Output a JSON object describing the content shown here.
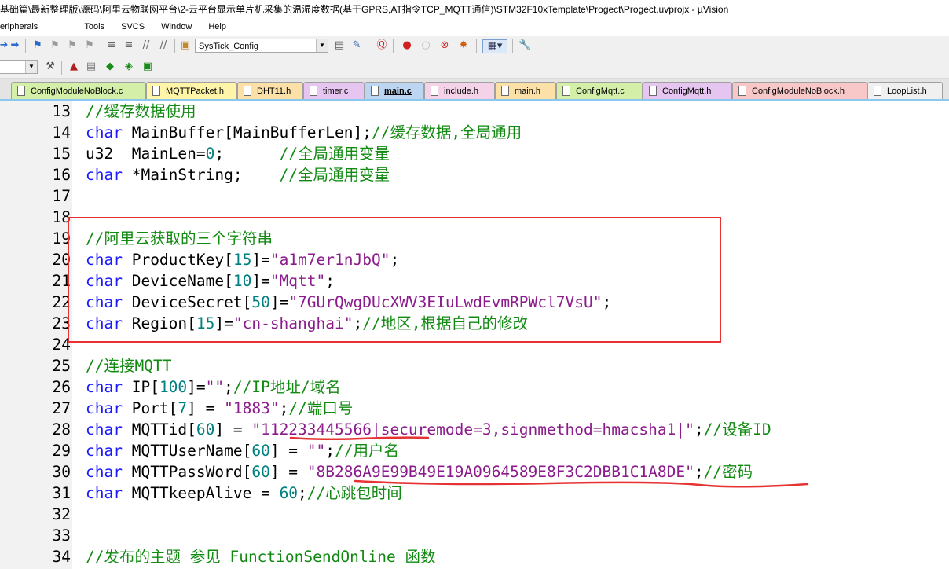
{
  "window": {
    "title": "基础篇\\最新整理版\\源码\\阿里云物联网平台\\2-云平台显示单片机采集的温湿度数据(基于GPRS,AT指令TCP_MQTT通信)\\STM32F10xTemplate\\Progect\\Progect.uvprojx - µVision"
  },
  "menu": [
    "eripherals",
    "Tools",
    "SVCS",
    "Window",
    "Help"
  ],
  "toolbar": {
    "target_combo": "SysTick_Config"
  },
  "tabs": [
    {
      "label": "ConfigModuleNoBlock.c",
      "color": "#d4f0a8"
    },
    {
      "label": "MQTTPacket.h",
      "color": "#fff5a8"
    },
    {
      "label": "DHT11.h",
      "color": "#fbe0a8"
    },
    {
      "label": "timer.c",
      "color": "#e6c6f0"
    },
    {
      "label": "main.c",
      "color": "#bcd6f2"
    },
    {
      "label": "include.h",
      "color": "#f4d2e8"
    },
    {
      "label": "main.h",
      "color": "#fbe0a8"
    },
    {
      "label": "ConfigMqtt.c",
      "color": "#d4f0a8"
    },
    {
      "label": "ConfigMqtt.h",
      "color": "#e6c6f0"
    },
    {
      "label": "ConfigModuleNoBlock.h",
      "color": "#f8c8c8"
    },
    {
      "label": "LoopList.h",
      "color": "#f0f0f0"
    }
  ],
  "code": [
    {
      "n": "13",
      "t": [
        [
          "cm",
          "//缓存数据使用"
        ]
      ]
    },
    {
      "n": "14",
      "t": [
        [
          "kw",
          "char"
        ],
        [
          "id",
          " MainBuffer[MainBufferLen];"
        ],
        [
          "cm",
          "//缓存数据,全局通用"
        ]
      ]
    },
    {
      "n": "15",
      "t": [
        [
          "id",
          "u32  MainLen="
        ],
        [
          "nm",
          "0"
        ],
        [
          "id",
          ";      "
        ],
        [
          "cm",
          "//全局通用变量"
        ]
      ]
    },
    {
      "n": "16",
      "t": [
        [
          "kw",
          "char"
        ],
        [
          "id",
          " *MainString;    "
        ],
        [
          "cm",
          "//全局通用变量"
        ]
      ]
    },
    {
      "n": "17",
      "t": []
    },
    {
      "n": "18",
      "t": []
    },
    {
      "n": "19",
      "t": [
        [
          "cm",
          "//阿里云获取的三个字符串"
        ]
      ]
    },
    {
      "n": "20",
      "t": [
        [
          "kw",
          "char"
        ],
        [
          "id",
          " ProductKey["
        ],
        [
          "nm",
          "15"
        ],
        [
          "id",
          "]="
        ],
        [
          "st",
          "\"a1m7er1nJbQ\""
        ],
        [
          "id",
          ";"
        ]
      ]
    },
    {
      "n": "21",
      "t": [
        [
          "kw",
          "char"
        ],
        [
          "id",
          " DeviceName["
        ],
        [
          "nm",
          "10"
        ],
        [
          "id",
          "]="
        ],
        [
          "st",
          "\"Mqtt\""
        ],
        [
          "id",
          ";"
        ]
      ]
    },
    {
      "n": "22",
      "t": [
        [
          "kw",
          "char"
        ],
        [
          "id",
          " DeviceSecret["
        ],
        [
          "nm",
          "50"
        ],
        [
          "id",
          "]="
        ],
        [
          "st",
          "\"7GUrQwgDUcXWV3EIuLwdEvmRPWcl7VsU\""
        ],
        [
          "id",
          ";"
        ]
      ]
    },
    {
      "n": "23",
      "t": [
        [
          "kw",
          "char"
        ],
        [
          "id",
          " Region["
        ],
        [
          "nm",
          "15"
        ],
        [
          "id",
          "]="
        ],
        [
          "st",
          "\"cn-shanghai\""
        ],
        [
          "id",
          ";"
        ],
        [
          "cm",
          "//地区,根据自己的修改"
        ]
      ]
    },
    {
      "n": "24",
      "t": []
    },
    {
      "n": "25",
      "t": [
        [
          "cm",
          "//连接MQTT"
        ]
      ]
    },
    {
      "n": "26",
      "t": [
        [
          "kw",
          "char"
        ],
        [
          "id",
          " IP["
        ],
        [
          "nm",
          "100"
        ],
        [
          "id",
          "]="
        ],
        [
          "st",
          "\"\""
        ],
        [
          "id",
          ";"
        ],
        [
          "cm",
          "//IP地址/域名"
        ]
      ]
    },
    {
      "n": "27",
      "t": [
        [
          "kw",
          "char"
        ],
        [
          "id",
          " Port["
        ],
        [
          "nm",
          "7"
        ],
        [
          "id",
          "] = "
        ],
        [
          "st",
          "\"1883\""
        ],
        [
          "id",
          ";"
        ],
        [
          "cm",
          "//端口号"
        ]
      ]
    },
    {
      "n": "28",
      "t": [
        [
          "kw",
          "char"
        ],
        [
          "id",
          " MQTTid["
        ],
        [
          "nm",
          "60"
        ],
        [
          "id",
          "] = "
        ],
        [
          "st",
          "\"112233445566|securemode=3,signmethod=hmacsha1|\""
        ],
        [
          "id",
          ";"
        ],
        [
          "cm",
          "//设备ID"
        ]
      ]
    },
    {
      "n": "29",
      "t": [
        [
          "kw",
          "char"
        ],
        [
          "id",
          " MQTTUserName["
        ],
        [
          "nm",
          "60"
        ],
        [
          "id",
          "] = "
        ],
        [
          "st",
          "\"\""
        ],
        [
          "id",
          ";"
        ],
        [
          "cm",
          "//用户名"
        ]
      ]
    },
    {
      "n": "30",
      "t": [
        [
          "kw",
          "char"
        ],
        [
          "id",
          " MQTTPassWord["
        ],
        [
          "nm",
          "60"
        ],
        [
          "id",
          "] = "
        ],
        [
          "st",
          "\"8B286A9E99B49E19A0964589E8F3C2DBB1C1A8DE\""
        ],
        [
          "id",
          ";"
        ],
        [
          "cm",
          "//密码"
        ]
      ]
    },
    {
      "n": "31",
      "t": [
        [
          "kw",
          "char"
        ],
        [
          "id",
          " MQTTkeepAlive = "
        ],
        [
          "nm",
          "60"
        ],
        [
          "id",
          ";"
        ],
        [
          "cm",
          "//心跳包时间"
        ]
      ]
    },
    {
      "n": "32",
      "t": []
    },
    {
      "n": "33",
      "t": []
    },
    {
      "n": "34",
      "t": [
        [
          "cm",
          "//发布的主题 参见 FunctionSendOnline 函数"
        ]
      ]
    }
  ]
}
